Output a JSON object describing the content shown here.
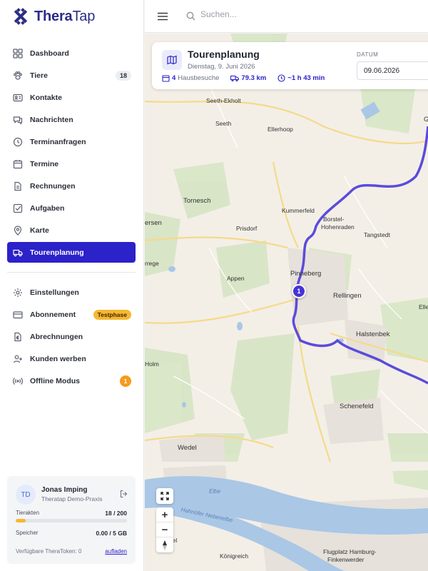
{
  "app": {
    "name_part1": "Thera",
    "name_part2": "Tap",
    "brand_color": "#2b22c9"
  },
  "topbar": {
    "menu_icon": "hamburger-icon",
    "search_placeholder": "Suchen..."
  },
  "sidebar": {
    "items": [
      {
        "label": "Dashboard",
        "icon": "grid-icon"
      },
      {
        "label": "Tiere",
        "icon": "paw-icon",
        "count": "18"
      },
      {
        "label": "Kontakte",
        "icon": "contact-card-icon"
      },
      {
        "label": "Nachrichten",
        "icon": "chat-icon"
      },
      {
        "label": "Terminanfragen",
        "icon": "clock-icon"
      },
      {
        "label": "Termine",
        "icon": "calendar-icon"
      },
      {
        "label": "Rechnungen",
        "icon": "document-icon"
      },
      {
        "label": "Aufgaben",
        "icon": "checkbox-icon"
      },
      {
        "label": "Karte",
        "icon": "pin-icon"
      },
      {
        "label": "Tourenplanung",
        "icon": "truck-icon",
        "active": true
      }
    ],
    "items2": [
      {
        "label": "Einstellungen",
        "icon": "gear-icon"
      },
      {
        "label": "Abonnement",
        "icon": "credit-card-icon",
        "badge": "Testphase"
      },
      {
        "label": "Abrechnungen",
        "icon": "euro-icon"
      },
      {
        "label": "Kunden werben",
        "icon": "add-user-icon"
      },
      {
        "label": "Offline Modus",
        "icon": "signal-icon",
        "badge_count": "1"
      }
    ]
  },
  "user": {
    "initials": "TD",
    "name": "Jonas Imping",
    "practice": "Theratap Demo-Praxis",
    "tierakten_label": "Tierakten",
    "tierakten_value": "18 / 200",
    "tierakten_fraction": 0.09,
    "speicher_label": "Speicher",
    "speicher_value": "0.00 / 5 GB",
    "speicher_fraction": 0,
    "token_text": "Verfügbare TheraToken: 0",
    "aufladen": "aufladen"
  },
  "tour": {
    "title": "Tourenplanung",
    "date_text": "Dienstag, 9. Juni 2026",
    "visits_count": "4",
    "visits_label": "Hausbesuche",
    "distance": "79.3 km",
    "duration": "~1 h 43 min",
    "datum_label": "DATUM",
    "datum_value": "09.06.2026"
  },
  "map": {
    "places": [
      "Seeth-Ekholt",
      "Seeth",
      "Ellerhoop",
      "Tornesch",
      "Kummerfeld",
      "Borstel-",
      "Hohenraden",
      "Tangstedt",
      "Prisdorf",
      "ersen",
      "rrege",
      "Appen",
      "Pinneberg",
      "Rellingen",
      "Halstenbek",
      "Elle",
      "Holm",
      "Schenefeld",
      "Wedel",
      "Elbe",
      "Hahnöfer Nebenelbe",
      "stel",
      "Königreich",
      "Flugplatz Hamburg-",
      "Finkenwerder",
      "G"
    ],
    "marker_label": "1",
    "zoom_in": "+",
    "zoom_out": "−",
    "route_color": "#5b4bdb"
  }
}
